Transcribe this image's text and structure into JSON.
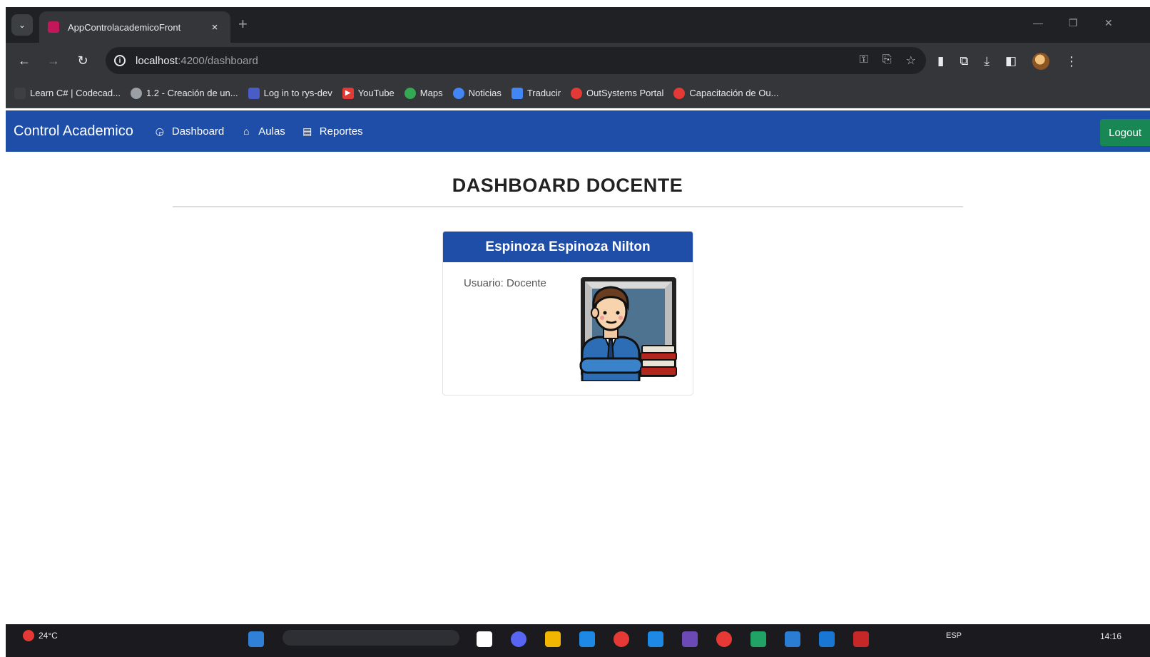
{
  "browser": {
    "tab_title": "AppControlacademicoFront",
    "tab_close": "×",
    "new_tab": "+",
    "url_host": "localhost",
    "url_path": ":4200/dashboard"
  },
  "bookmarks": [
    {
      "label": "Learn C# | Codecad...",
      "icon_color": "#3c4043"
    },
    {
      "label": "1.2 - Creación de un...",
      "icon_color": "#9aa0a6"
    },
    {
      "label": "Log in to rys-dev",
      "icon_color": "#4a5cc7"
    },
    {
      "label": "YouTube",
      "icon_color": "#e53935"
    },
    {
      "label": "Maps",
      "icon_color": "#34a853"
    },
    {
      "label": "Noticias",
      "icon_color": "#4285f4"
    },
    {
      "label": "Traducir",
      "icon_color": "#4285f4"
    },
    {
      "label": "OutSystems Portal",
      "icon_color": "#e53935"
    },
    {
      "label": "Capacitación de Ou...",
      "icon_color": "#e53935"
    }
  ],
  "navbar": {
    "brand": "Control Academico",
    "links": [
      {
        "label": "Dashboard",
        "icon": "dashboard-icon"
      },
      {
        "label": "Aulas",
        "icon": "classroom-icon"
      },
      {
        "label": "Reportes",
        "icon": "report-icon"
      }
    ],
    "logout": "Logout",
    "color": "#1f4ea8",
    "logout_color": "#198754"
  },
  "main": {
    "title": "DASHBOARD DOCENTE",
    "card": {
      "name": "Espinoza Espinoza Nilton",
      "user_label": "Usuario: Docente",
      "image": "teacher-avatar-icon"
    }
  },
  "taskbar": {
    "weather": "24°C",
    "lang": "ESP",
    "time": "14:16"
  }
}
